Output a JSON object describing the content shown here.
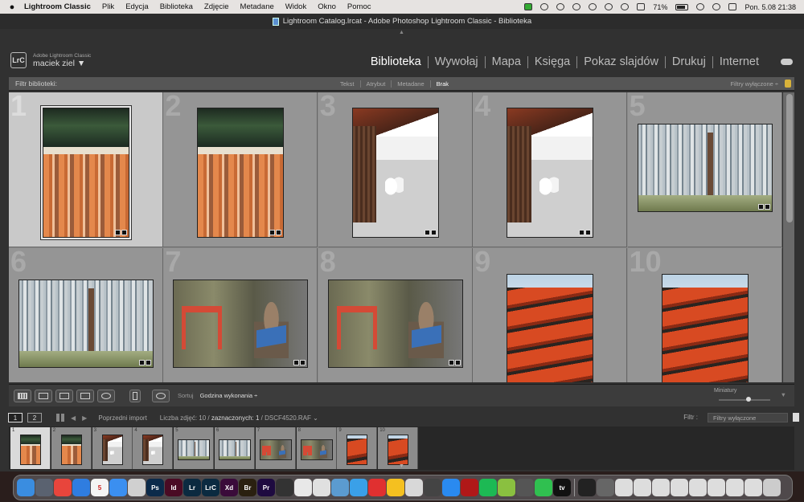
{
  "menubar": {
    "app": "Lightroom Classic",
    "items": [
      "Plik",
      "Edycja",
      "Biblioteka",
      "Zdjęcie",
      "Metadane",
      "Widok",
      "Okno",
      "Pomoc"
    ],
    "battery": "71%",
    "clock": "Pon. 5.08  21:38"
  },
  "window": {
    "title": "Lightroom Catalog.lrcat - Adobe Photoshop Lightroom Classic - Biblioteka"
  },
  "identity": {
    "logo": "LrC",
    "product": "Adobe Lightroom Classic",
    "user": "maciek ziel ▼"
  },
  "modules": [
    "Biblioteka",
    "Wywołaj",
    "Mapa",
    "Księga",
    "Pokaz slajdów",
    "Drukuj",
    "Internet"
  ],
  "filterbar": {
    "label": "Filtr biblioteki:",
    "tabs": [
      "Tekst",
      "Atrybut",
      "Metadane",
      "Brak"
    ],
    "active_tab": "Brak",
    "presets": "Filtry wyłączone ÷"
  },
  "grid": {
    "cells": [
      {
        "num": "1",
        "photo": "torii",
        "selected": true
      },
      {
        "num": "2",
        "photo": "torii",
        "selected": false
      },
      {
        "num": "3",
        "photo": "temple",
        "selected": false
      },
      {
        "num": "4",
        "photo": "temple",
        "selected": false
      },
      {
        "num": "5",
        "photo": "bamboo",
        "selected": false
      },
      {
        "num": "6",
        "photo": "bamboo",
        "selected": false
      },
      {
        "num": "7",
        "photo": "fox",
        "selected": false
      },
      {
        "num": "8",
        "photo": "fox",
        "selected": false
      },
      {
        "num": "9",
        "photo": "pagoda",
        "selected": false
      },
      {
        "num": "10",
        "photo": "pagoda",
        "selected": false
      }
    ]
  },
  "toolbar": {
    "sort_label": "Sortuj",
    "sort_value": "Godzina wykonania ÷",
    "thumbs_label": "Miniatury"
  },
  "filmstrip_header": {
    "screen1": "1",
    "screen2": "2",
    "source": "Poprzedni import",
    "count_prefix": "Liczba zdjęć: 10 /",
    "count_selected": " zaznaczonych: 1 ",
    "count_file": "/ DSCF4520.RAF ⌄",
    "filter_label": "Filtr :",
    "filter_value": "Filtry wyłączone"
  },
  "dock": {
    "apps": [
      {
        "label": "",
        "color": "#3a8de0"
      },
      {
        "label": "",
        "color": "#5a6270"
      },
      {
        "label": "",
        "color": "#e8453c"
      },
      {
        "label": "",
        "color": "#2f7de0"
      },
      {
        "label": "5",
        "color": "#f4f4f4"
      },
      {
        "label": "",
        "color": "#3b8ff0"
      },
      {
        "label": "",
        "color": "#d0d0d0"
      },
      {
        "label": "Ps",
        "color": "#0b2a4a"
      },
      {
        "label": "Id",
        "color": "#4a0b24"
      },
      {
        "label": "Lr",
        "color": "#0b2a40"
      },
      {
        "label": "LrC",
        "color": "#0b2a40"
      },
      {
        "label": "Xd",
        "color": "#3a0b3a"
      },
      {
        "label": "Br",
        "color": "#2a2010"
      },
      {
        "label": "Pr",
        "color": "#1e0b40"
      },
      {
        "label": "",
        "color": "#333"
      },
      {
        "label": "",
        "color": "#e8e8e8"
      },
      {
        "label": "",
        "color": "#e0e0e0"
      },
      {
        "label": "",
        "color": "#5b9bd0"
      },
      {
        "label": "",
        "color": "#3aa0e8"
      },
      {
        "label": "",
        "color": "#e03030"
      },
      {
        "label": "",
        "color": "#f4c020"
      },
      {
        "label": "",
        "color": "#d8d8d8"
      },
      {
        "label": "",
        "color": "#444"
      },
      {
        "label": "",
        "color": "#2a8af0"
      },
      {
        "label": "",
        "color": "#b01818"
      },
      {
        "label": "",
        "color": "#1db954"
      },
      {
        "label": "",
        "color": "#8ac040"
      },
      {
        "label": "",
        "color": "#555"
      },
      {
        "label": "",
        "color": "#30c050"
      },
      {
        "label": "tv",
        "color": "#111"
      },
      {
        "label": "",
        "color": "#222"
      },
      {
        "label": "",
        "color": "#666"
      },
      {
        "label": "",
        "color": "#ddd"
      },
      {
        "label": "",
        "color": "#ddd"
      },
      {
        "label": "",
        "color": "#ddd"
      },
      {
        "label": "",
        "color": "#ddd"
      },
      {
        "label": "",
        "color": "#ddd"
      },
      {
        "label": "",
        "color": "#ddd"
      },
      {
        "label": "",
        "color": "#ddd"
      },
      {
        "label": "",
        "color": "#ddd"
      },
      {
        "label": "",
        "color": "#ccc"
      }
    ]
  }
}
